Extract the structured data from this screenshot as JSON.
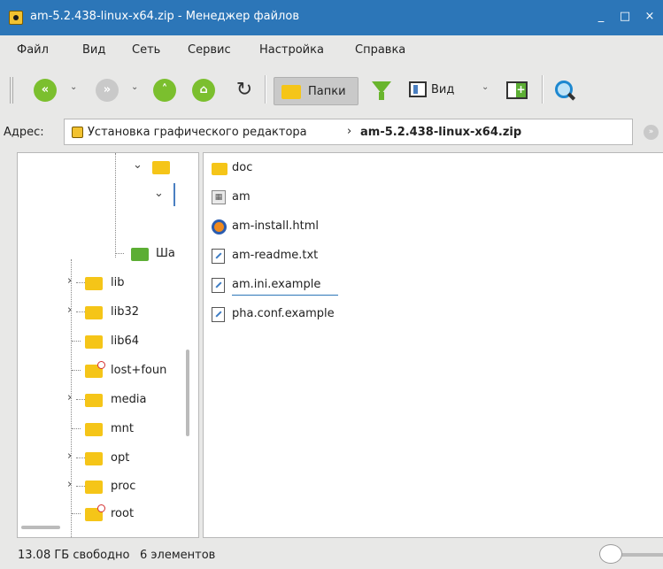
{
  "window": {
    "title": "am-5.2.438-linux-x64.zip - Менеджер файлов",
    "minimize": "_",
    "maximize": "□",
    "close": "×"
  },
  "menu": [
    "Файл",
    "Вид",
    "Сеть",
    "Сервис",
    "Настройка",
    "Справка"
  ],
  "toolbar": {
    "folders_label": "Папки",
    "view_label": "Вид",
    "back_glyph": "«",
    "forward_glyph": "»",
    "up_glyph": "˄",
    "home_glyph": "⌂",
    "reload_glyph": "↻",
    "dropdown_glyph": "⌄"
  },
  "address": {
    "label": "Адрес:",
    "parent": "Установка графического редактора",
    "separator": "›",
    "current": "am-5.2.438-linux-x64.zip",
    "go_glyph": "»"
  },
  "tree": {
    "expander_open": "⌄",
    "expander_closed": "›",
    "items": [
      {
        "name": "",
        "icon": "folder"
      },
      {
        "name": "",
        "icon": "folder"
      },
      {
        "name": "Ша",
        "icon": "folder-green"
      },
      {
        "name": "lib",
        "icon": "folder"
      },
      {
        "name": "lib32",
        "icon": "folder"
      },
      {
        "name": "lib64",
        "icon": "folder"
      },
      {
        "name": "lost+foun",
        "icon": "folder-locked"
      },
      {
        "name": "media",
        "icon": "folder"
      },
      {
        "name": "mnt",
        "icon": "folder"
      },
      {
        "name": "opt",
        "icon": "folder"
      },
      {
        "name": "proc",
        "icon": "folder"
      },
      {
        "name": "root",
        "icon": "folder-locked"
      }
    ]
  },
  "files": [
    {
      "name": "doc",
      "icon": "folder-icon"
    },
    {
      "name": "am",
      "icon": "executable-icon"
    },
    {
      "name": "am-install.html",
      "icon": "firefox-icon"
    },
    {
      "name": "am-readme.txt",
      "icon": "text-file-icon"
    },
    {
      "name": "am.ini.example",
      "icon": "text-file-icon"
    },
    {
      "name": "pha.conf.example",
      "icon": "text-file-icon"
    }
  ],
  "status": {
    "free_space": "13.08 ГБ свободно",
    "count": "6 элементов"
  },
  "colors": {
    "titlebar": "#2c76b8",
    "accent_green": "#7bbf2e",
    "folder": "#f5c518"
  }
}
